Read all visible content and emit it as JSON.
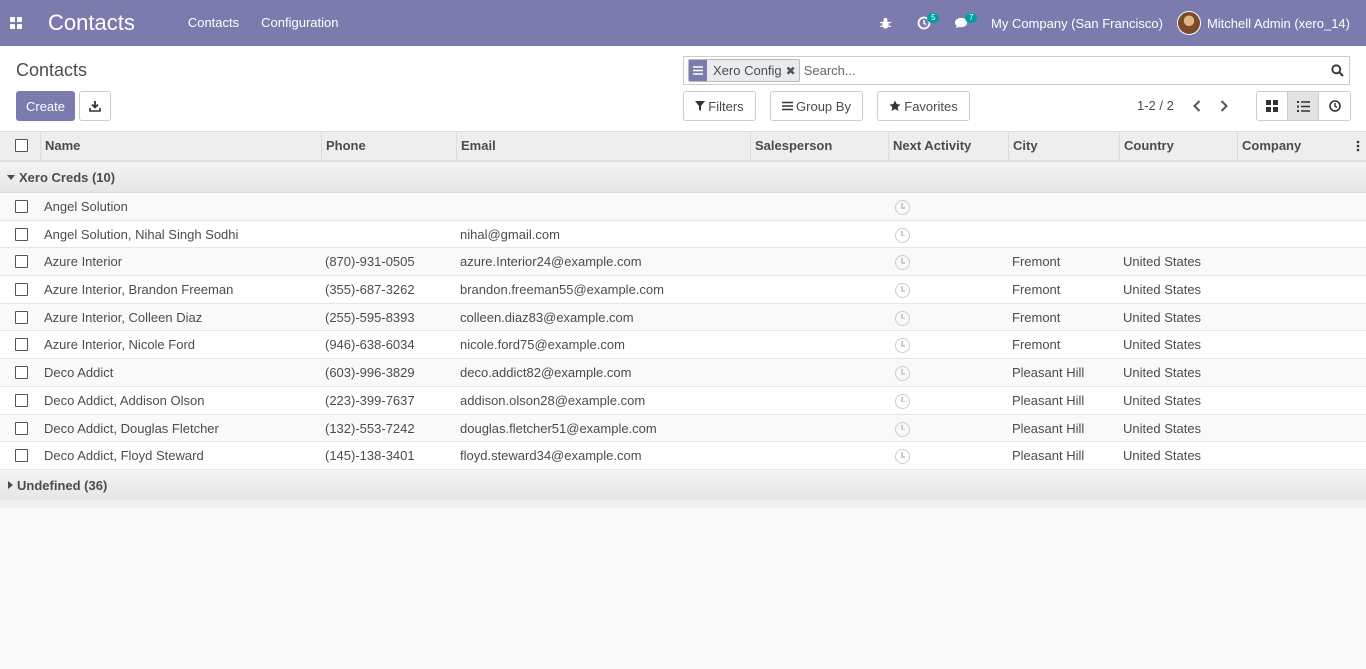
{
  "navbar": {
    "app_title": "Contacts",
    "menu": [
      "Contacts",
      "Configuration"
    ],
    "activity_count": "5",
    "messages_count": "7",
    "company": "My Company (San Francisco)",
    "user": "Mitchell Admin (xero_14)",
    "color": "#7c7bad"
  },
  "control": {
    "breadcrumb": "Contacts",
    "create_label": "Create",
    "filters_label": "Filters",
    "groupby_label": "Group By",
    "favorites_label": "Favorites",
    "pager": "1-2 / 2"
  },
  "search": {
    "facet": "Xero Config",
    "placeholder": "Search..."
  },
  "columns": [
    "Name",
    "Phone",
    "Email",
    "Salesperson",
    "Next Activity",
    "City",
    "Country",
    "Company"
  ],
  "groups": [
    {
      "label": "Xero Creds (10)",
      "rows": [
        {
          "name": "Angel Solution",
          "phone": "",
          "email": "",
          "city": "",
          "country": ""
        },
        {
          "name": "Angel Solution, Nihal Singh Sodhi",
          "phone": "",
          "email": "nihal@gmail.com",
          "city": "",
          "country": ""
        },
        {
          "name": "Azure Interior",
          "phone": "(870)-931-0505",
          "email": "azure.Interior24@example.com",
          "city": "Fremont",
          "country": "United States"
        },
        {
          "name": "Azure Interior, Brandon Freeman",
          "phone": "(355)-687-3262",
          "email": "brandon.freeman55@example.com",
          "city": "Fremont",
          "country": "United States"
        },
        {
          "name": "Azure Interior, Colleen Diaz",
          "phone": "(255)-595-8393",
          "email": "colleen.diaz83@example.com",
          "city": "Fremont",
          "country": "United States"
        },
        {
          "name": "Azure Interior, Nicole Ford",
          "phone": "(946)-638-6034",
          "email": "nicole.ford75@example.com",
          "city": "Fremont",
          "country": "United States"
        },
        {
          "name": "Deco Addict",
          "phone": "(603)-996-3829",
          "email": "deco.addict82@example.com",
          "city": "Pleasant Hill",
          "country": "United States"
        },
        {
          "name": "Deco Addict, Addison Olson",
          "phone": "(223)-399-7637",
          "email": "addison.olson28@example.com",
          "city": "Pleasant Hill",
          "country": "United States"
        },
        {
          "name": "Deco Addict, Douglas Fletcher",
          "phone": "(132)-553-7242",
          "email": "douglas.fletcher51@example.com",
          "city": "Pleasant Hill",
          "country": "United States"
        },
        {
          "name": "Deco Addict, Floyd Steward",
          "phone": "(145)-138-3401",
          "email": "floyd.steward34@example.com",
          "city": "Pleasant Hill",
          "country": "United States"
        }
      ]
    },
    {
      "label": "Undefined (36)",
      "rows": []
    }
  ]
}
